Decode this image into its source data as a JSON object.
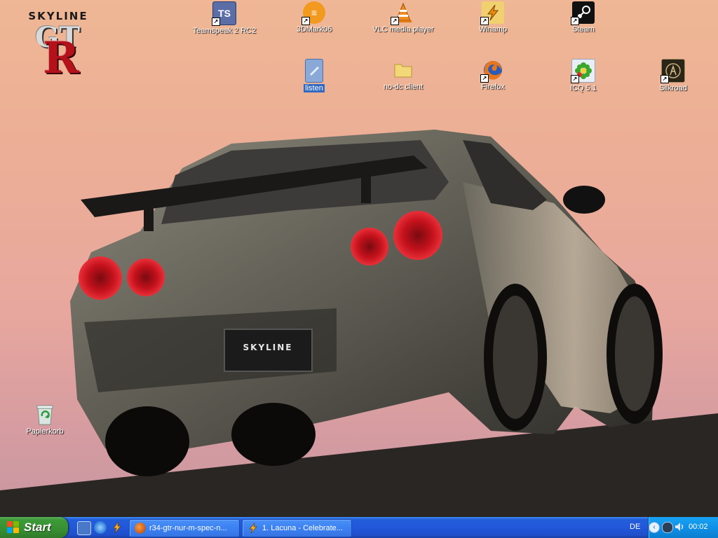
{
  "wallpaper": {
    "logo": {
      "brand": "SKYLINE",
      "gt": "GT",
      "r": "R"
    }
  },
  "desktop_icons": [
    {
      "label": "Teamspeak 2 RC2",
      "icon": "teamspeak-icon",
      "shortcut": true,
      "selected": false
    },
    {
      "label": "3DMark06",
      "icon": "3dmark-icon",
      "shortcut": true,
      "selected": false
    },
    {
      "label": "VLC media player",
      "icon": "vlc-icon",
      "shortcut": true,
      "selected": false
    },
    {
      "label": "Winamp",
      "icon": "winamp-icon",
      "shortcut": true,
      "selected": false
    },
    {
      "label": "Steam",
      "icon": "steam-icon",
      "shortcut": true,
      "selected": false
    },
    {
      "label": "listen",
      "icon": "document-icon",
      "shortcut": false,
      "selected": true
    },
    {
      "label": "no-dc client",
      "icon": "folder-icon",
      "shortcut": false,
      "selected": false
    },
    {
      "label": "Firefox",
      "icon": "firefox-icon",
      "shortcut": true,
      "selected": false
    },
    {
      "label": "ICQ 5.1",
      "icon": "icq-icon",
      "shortcut": true,
      "selected": false
    },
    {
      "label": "Silkroad",
      "icon": "silkroad-icon",
      "shortcut": true,
      "selected": false
    },
    {
      "label": "Papierkorb",
      "icon": "recycle-bin-icon",
      "shortcut": false,
      "selected": false
    }
  ],
  "taskbar": {
    "start_label": "Start",
    "quick_launch": [
      {
        "icon": "show-desktop-icon"
      },
      {
        "icon": "internet-explorer-icon"
      },
      {
        "icon": "winamp-icon"
      }
    ],
    "tasks": [
      {
        "label": "r34-gtr-nur-m-spec-n...",
        "icon": "firefox-icon",
        "active": false
      },
      {
        "label": "1. Lacuna - Celebrate...",
        "icon": "winamp-icon",
        "active": false
      }
    ],
    "tray": {
      "language": "DE",
      "clock": "00:02",
      "icons": [
        "collapse-arrow-icon",
        "network-icon",
        "volume-icon"
      ]
    }
  },
  "colors": {
    "taskbar_blue": "#245edb",
    "start_green": "#3c9a37",
    "selection_blue": "#316ac5",
    "tail_light_red": "#c4121c"
  }
}
